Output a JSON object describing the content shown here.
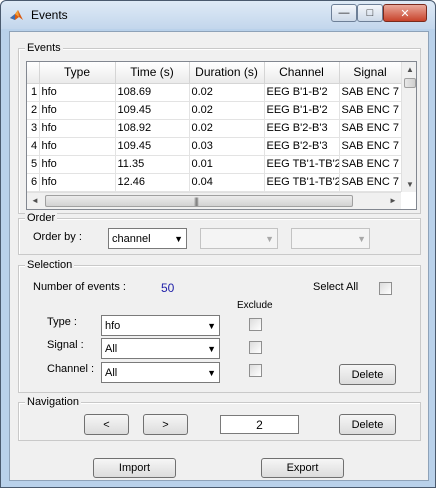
{
  "window": {
    "title": "Events",
    "minimize_glyph": "—",
    "maximize_glyph": "□",
    "close_glyph": "✕"
  },
  "events_panel": {
    "title": "Events",
    "columns": [
      "",
      "Type",
      "Time (s)",
      "Duration (s)",
      "Channel",
      "Signal"
    ],
    "rows": [
      [
        "1",
        "hfo",
        "108.69",
        "0.02",
        "EEG B'1-B'2",
        "SAB ENC 7"
      ],
      [
        "2",
        "hfo",
        "109.45",
        "0.02",
        "EEG B'1-B'2",
        "SAB ENC 7"
      ],
      [
        "3",
        "hfo",
        "108.92",
        "0.02",
        "EEG B'2-B'3",
        "SAB ENC 7"
      ],
      [
        "4",
        "hfo",
        "109.45",
        "0.03",
        "EEG B'2-B'3",
        "SAB ENC 7"
      ],
      [
        "5",
        "hfo",
        "11.35",
        "0.01",
        "EEG TB'1-TB'2",
        "SAB ENC 7"
      ],
      [
        "6",
        "hfo",
        "12.46",
        "0.04",
        "EEG TB'1-TB'2",
        "SAB ENC 7"
      ]
    ],
    "scroll_up_glyph": "▲",
    "scroll_down_glyph": "▼",
    "scroll_left_glyph": "◄",
    "scroll_right_glyph": "►",
    "grip_glyph": "|||"
  },
  "order_panel": {
    "title": "Order",
    "order_by_label": "Order by :",
    "order_by_value": "channel",
    "dropdown_glyph": "▼"
  },
  "selection_panel": {
    "title": "Selection",
    "num_events_label": "Number of events :",
    "num_events_value": "50",
    "select_all_label": "Select All",
    "exclude_label": "Exclude",
    "type_label": "Type :",
    "type_value": "hfo",
    "signal_label": "Signal :",
    "signal_value": "All",
    "channel_label": "Channel :",
    "channel_value": "All",
    "delete_label": "Delete"
  },
  "navigation_panel": {
    "title": "Navigation",
    "prev_label": "<",
    "next_label": ">",
    "page_value": "2",
    "delete_label": "Delete"
  },
  "footer": {
    "import_label": "Import",
    "export_label": "Export"
  },
  "colors": {
    "count_value": "#1f1fa8",
    "title_bar": "#c3d6ec",
    "close_button": "#c8432b"
  }
}
